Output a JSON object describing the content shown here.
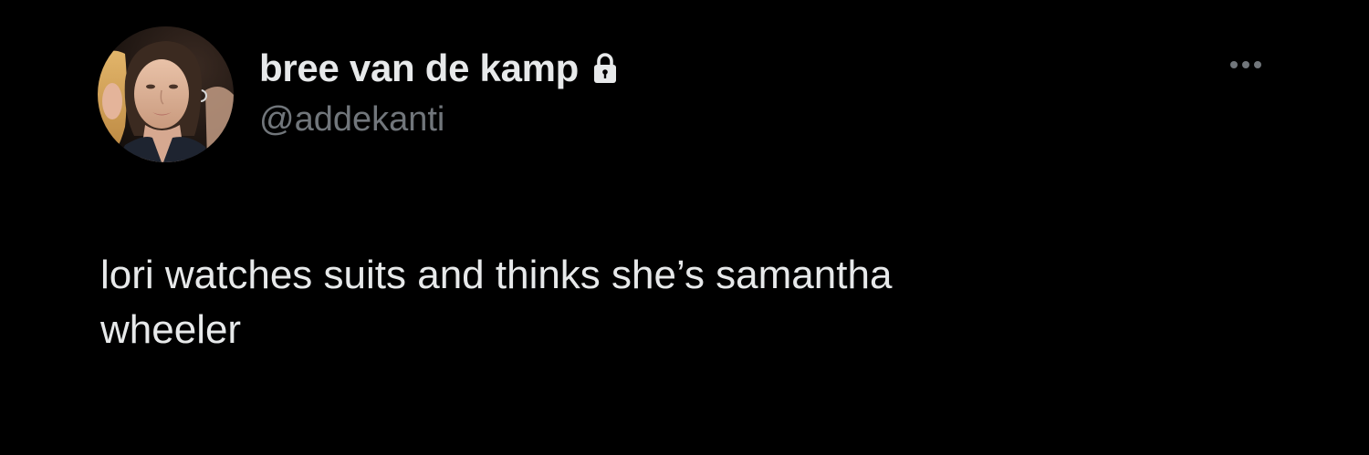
{
  "tweet": {
    "author": {
      "display_name": "bree van de kamp",
      "handle": "@addekanti",
      "protected_icon": "lock-icon",
      "avatar": "avatar-photo"
    },
    "more_icon": "more-options-icon",
    "text": "lori watches suits and thinks she’s samantha\nwheeler"
  },
  "colors": {
    "background": "#000000",
    "primary_text": "#e7e9ea",
    "secondary_text": "#71767b"
  }
}
